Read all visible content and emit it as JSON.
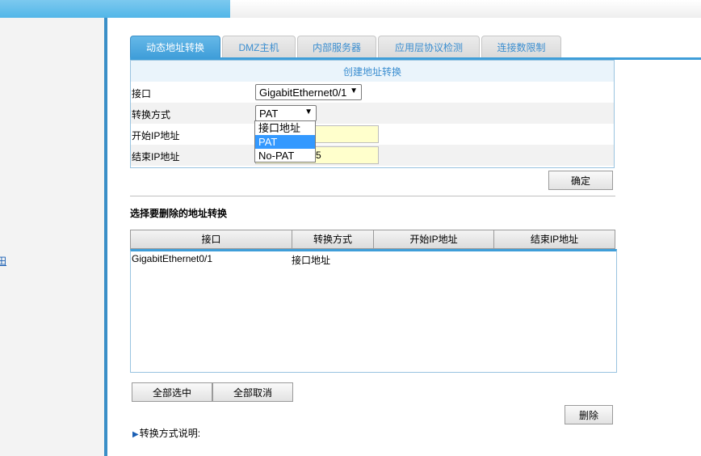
{
  "left_nav": {
    "partial_link": "田"
  },
  "tabs": [
    {
      "label": "动态地址转换",
      "active": true
    },
    {
      "label": "DMZ主机",
      "active": false
    },
    {
      "label": "内部服务器",
      "active": false
    },
    {
      "label": "应用层协议检测",
      "active": false
    },
    {
      "label": "连接数限制",
      "active": false
    }
  ],
  "form": {
    "header": "创建地址转换",
    "interface_label": "接口",
    "interface_value": "GigabitEthernet0/1",
    "mode_label": "转换方式",
    "mode_value": "PAT",
    "mode_options": [
      "接口地址",
      "PAT",
      "No-PAT"
    ],
    "mode_selected_option": "PAT",
    "start_ip_label": "开始IP地址",
    "end_ip_label": "结束IP地址",
    "end_ip_visible_tail": "5",
    "confirm_button": "确定"
  },
  "delete_section": {
    "title": "选择要删除的地址转换",
    "columns": [
      "接口",
      "转换方式",
      "开始IP地址",
      "结束IP地址"
    ],
    "rows": [
      {
        "interface": "GigabitEthernet0/1",
        "mode": "接口地址",
        "start_ip": "",
        "end_ip": ""
      }
    ],
    "select_all_button": "全部选中",
    "deselect_all_button": "全部取消",
    "delete_button": "删除"
  },
  "footer": {
    "note": "转换方式说明:"
  },
  "colors": {
    "accent": "#3f9ed9",
    "tab_text": "#3b8ed0",
    "input_highlight": "#ffffcc",
    "option_selected": "#3399ff"
  }
}
